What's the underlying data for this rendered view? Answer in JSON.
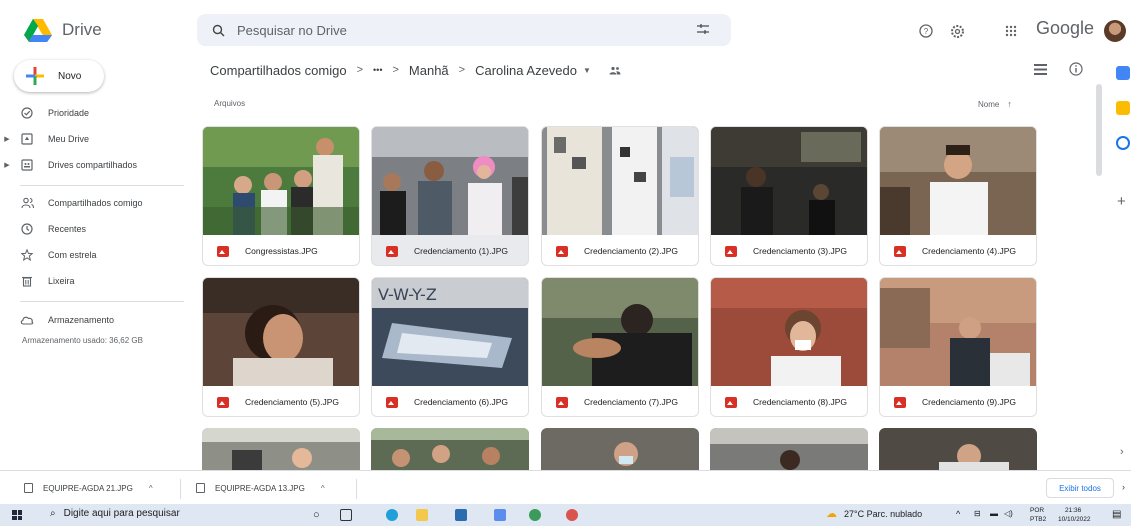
{
  "header": {
    "app_name": "Drive",
    "search_placeholder": "Pesquisar no Drive",
    "google_label": "Google"
  },
  "sidebar": {
    "new_label": "Novo",
    "items": [
      {
        "label": "Prioridade",
        "icon": "check-circle-icon"
      },
      {
        "label": "Meu Drive",
        "icon": "my-drive-icon"
      },
      {
        "label": "Drives compartilhados",
        "icon": "shared-drives-icon"
      },
      {
        "label": "Compartilhados comigo",
        "icon": "shared-with-me-icon"
      },
      {
        "label": "Recentes",
        "icon": "clock-icon"
      },
      {
        "label": "Com estrela",
        "icon": "star-icon"
      },
      {
        "label": "Lixeira",
        "icon": "trash-icon"
      },
      {
        "label": "Armazenamento",
        "icon": "cloud-icon"
      }
    ],
    "storage_used": "Armazenamento usado: 36,62 GB"
  },
  "breadcrumb": {
    "root": "Compartilhados comigo",
    "ellipsis": "•••",
    "parent": "Manhã",
    "current": "Carolina Azevedo"
  },
  "files": {
    "section_label": "Arquivos",
    "sort_label": "Nome",
    "items": [
      {
        "name": "Congressistas.JPG"
      },
      {
        "name": "Credenciamento (1).JPG"
      },
      {
        "name": "Credenciamento (2).JPG"
      },
      {
        "name": "Credenciamento (3).JPG"
      },
      {
        "name": "Credenciamento (4).JPG"
      },
      {
        "name": "Credenciamento (5).JPG"
      },
      {
        "name": "Credenciamento (6).JPG"
      },
      {
        "name": "Credenciamento (7).JPG"
      },
      {
        "name": "Credenciamento (8).JPG"
      },
      {
        "name": "Credenciamento (9).JPG"
      }
    ]
  },
  "downloads": {
    "items": [
      {
        "name": "EQUIPRE-AGDA 21.JPG"
      },
      {
        "name": "EQUIPRE-AGDA 13.JPG"
      }
    ],
    "show_all": "Exibir todos"
  },
  "taskbar": {
    "search_placeholder": "Digite aqui para pesquisar",
    "weather": "27°C  Parc. nublado",
    "lang_top": "POR",
    "lang_bottom": "PTB2",
    "time": "21:36",
    "date": "10/10/2022"
  }
}
